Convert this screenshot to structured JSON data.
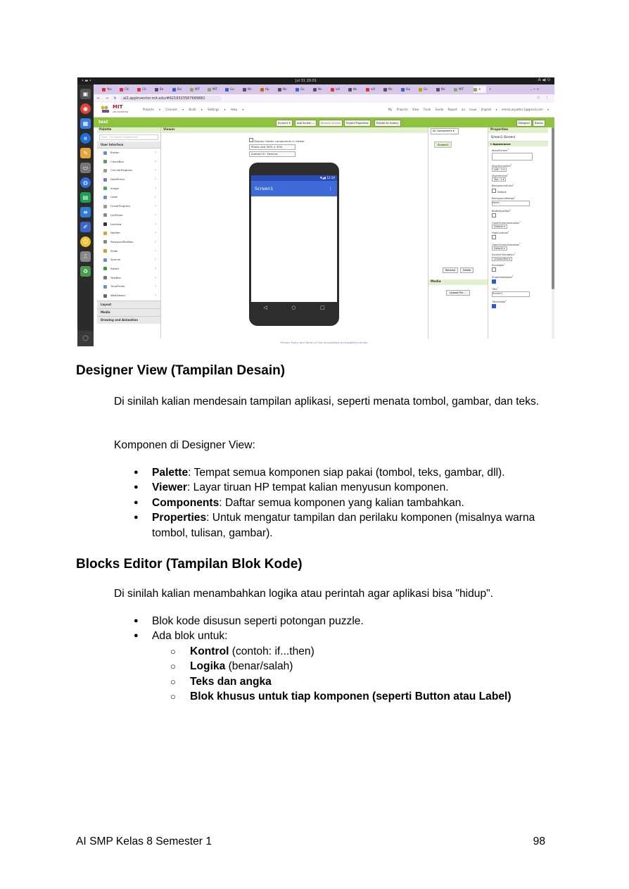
{
  "screenshot": {
    "topbar": {
      "clock": "Jul 31 20:01"
    },
    "tabs": [
      "Yoo",
      "Chi",
      "(3)",
      "Be",
      "Bui",
      "MIT",
      "MIT",
      "Go",
      "Ne",
      "Hp",
      "Ne",
      "Go",
      "Ne",
      "sof",
      "Ne",
      "sof",
      "Ne",
      "Bui",
      "Go",
      "Ne",
      "MIT"
    ],
    "browser": {
      "url": "ai2.appinventor.mit.edu/#6219323567689881",
      "nav_icons": "← → ↻",
      "right_icons": "☆ ⋮"
    },
    "app_header": {
      "brand": "MIT",
      "sub": "APP INVENTOR",
      "menu": "Projects ▾ Connect ▾ Build ▾ Settings ▾ Help ▾",
      "right_menu": "My Projects View Trash Guide Report an Issue English ▾ emma.w.putter.1@gmail.com ▾"
    },
    "toolbar": {
      "project_name": "test",
      "buttons": [
        "Screen1 ▾",
        "Add Screen ...",
        "Remove Screen",
        "Project Properties",
        "Publish to Gallery"
      ],
      "designer": "Designer",
      "blocks": "Blocks"
    },
    "palette": {
      "header": "Palette",
      "search_placeholder": "Type → to search components",
      "category": "User Interface",
      "items": [
        "Button",
        "CheckBox",
        "CircularProgress",
        "DatePicker",
        "Image",
        "Label",
        "LinearProgress",
        "ListPicker",
        "ListView",
        "Notifier",
        "PasswordTextBox",
        "Slider",
        "Spinner",
        "Switch",
        "TextBox",
        "TimePicker",
        "WebViewer"
      ],
      "help_mark": "?",
      "bottom_categories": [
        "Layout",
        "Media",
        "Drawing and Animation"
      ]
    },
    "viewer": {
      "header": "Viewer",
      "hidden_label": "Display hidden components in Viewer",
      "size_option": "Phone size (505 × 320)",
      "theme_option": "Android 5+ Devices",
      "status_time": "▼◢▮ 12:30",
      "screen_title": "Screen1",
      "kebab": "⋮",
      "nav_buttons": [
        "◁",
        "○",
        "□"
      ]
    },
    "components": {
      "header": "All Components ▾",
      "tree_root": "Screen1",
      "rename": "Rename",
      "delete": "Delete",
      "media_header": "Media",
      "upload": "Upload File ..."
    },
    "properties": {
      "header": "Properties",
      "screen": "Screen1 (Screen)",
      "category": "▾ Appearance",
      "items": [
        {
          "name": "AboutScreen",
          "kind": "textarea",
          "value": ""
        },
        {
          "name": "AlignHorizontal",
          "kind": "dropdown",
          "value": "Left : 1 ▾"
        },
        {
          "name": "AlignVertical",
          "kind": "dropdown",
          "value": "Top : 1 ▾"
        },
        {
          "name": "BackgroundColor",
          "kind": "color",
          "value": "Default"
        },
        {
          "name": "BackgroundImage",
          "kind": "text",
          "value": "None..."
        },
        {
          "name": "BigDefaultText",
          "kind": "checkbox",
          "value": ""
        },
        {
          "name": "CloseScreenAnimation",
          "kind": "dropdown",
          "value": "Default ▾"
        },
        {
          "name": "HighContrast",
          "kind": "checkbox",
          "value": ""
        },
        {
          "name": "OpenScreenAnimation",
          "kind": "dropdown",
          "value": "Default ▾"
        },
        {
          "name": "ScreenOrientation",
          "kind": "dropdown",
          "value": "Unspecified ▾"
        },
        {
          "name": "Scrollable",
          "kind": "checkbox",
          "value": ""
        },
        {
          "name": "ShowListsAsJson",
          "kind": "checkbox-on",
          "value": ""
        },
        {
          "name": "Title",
          "kind": "text",
          "value": "Screen1"
        },
        {
          "name": "TitleVisible",
          "kind": "checkbox-on",
          "value": ""
        }
      ],
      "help_mark": "?"
    },
    "footer_links": "Privacy Policy and Terms of Use     Accessibility  accessibility.mit.edu"
  },
  "doc": {
    "section1": {
      "title": "Designer View (Tampilan Desain)",
      "intro": "Di sinilah kalian mendesain tampilan aplikasi, seperti menata tombol, gambar, dan teks.",
      "lead": "Komponen di Designer View:",
      "bullets": [
        {
          "term": "Palette",
          "desc": ": Tempat semua komponen siap pakai (tombol, teks, gambar, dll)."
        },
        {
          "term": "Viewer",
          "desc": ": Layar tiruan HP tempat kalian menyusun komponen."
        },
        {
          "term": "Components",
          "desc": ": Daftar semua komponen yang kalian tambahkan."
        },
        {
          "term": "Properties",
          "desc": ": Untuk mengatur tampilan dan perilaku komponen (misalnya warna tombol, tulisan, gambar)."
        }
      ]
    },
    "section2": {
      "title": "Blocks Editor (Tampilan Blok Kode)",
      "intro": "Di sinilah kalian menambahkan logika atau perintah agar aplikasi bisa \"hidup\".",
      "bullet1": "Blok kode disusun seperti potongan puzzle.",
      "bullet2": "Ada blok untuk:",
      "sub": [
        {
          "term": "Kontrol",
          "desc": " (contoh: if...then)"
        },
        {
          "term": "Logika",
          "desc": " (benar/salah)"
        },
        {
          "term": "Teks dan angka",
          "desc": ""
        },
        {
          "term": "Blok khusus untuk tiap komponen (seperti Button atau Label)",
          "desc": ""
        }
      ]
    },
    "footer": {
      "left": "AI SMP Kelas 8 Semester 1",
      "page": "98"
    }
  }
}
